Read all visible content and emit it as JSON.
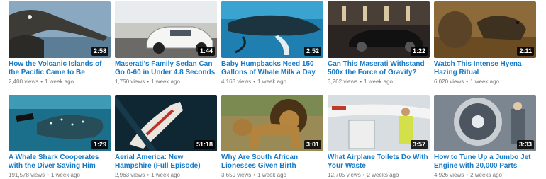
{
  "videos": [
    {
      "title": "How the Volcanic Islands of the Pacific Came to Be",
      "duration": "2:58",
      "views": "2,400 views",
      "age": "1 week ago",
      "scene": "bird"
    },
    {
      "title": "Maserati's Family Sedan Can Go 0-60 in Under 4.8 Seconds",
      "duration": "1:44",
      "views": "1,750 views",
      "age": "1 week ago",
      "scene": "white-car"
    },
    {
      "title": "Baby Humpbacks Need 150 Gallons of Whale Milk a Day",
      "duration": "2:52",
      "views": "4,163 views",
      "age": "1 week ago",
      "scene": "whale"
    },
    {
      "title": "Can This Maserati Withstand 500x the Force of Gravity?",
      "duration": "1:22",
      "views": "3,262 views",
      "age": "1 week ago",
      "scene": "black-car"
    },
    {
      "title": "Watch This Intense Hyena Hazing Ritual",
      "duration": "2:11",
      "views": "6,020 views",
      "age": "1 week ago",
      "scene": "hyena"
    },
    {
      "title": "A Whale Shark Cooperates with the Diver Saving Him",
      "duration": "1:29",
      "views": "191,578 views",
      "age": "1 week ago",
      "scene": "whale-shark"
    },
    {
      "title": "Aerial America: New Hampshire (Full Episode)",
      "duration": "51:18",
      "views": "2,963 views",
      "age": "1 week ago",
      "scene": "boat"
    },
    {
      "title": "Why Are South African Lionesses Given Birth Control?",
      "duration": "3:01",
      "views": "3,659 views",
      "age": "1 week ago",
      "scene": "lions"
    },
    {
      "title": "What Airplane Toilets Do With Your Waste",
      "duration": "3:57",
      "views": "12,705 views",
      "age": "2 weeks ago",
      "scene": "airplane"
    },
    {
      "title": "How to Tune Up a Jumbo Jet Engine with 20,000 Parts",
      "duration": "3:33",
      "views": "4,926 views",
      "age": "2 weeks ago",
      "scene": "engine"
    }
  ]
}
